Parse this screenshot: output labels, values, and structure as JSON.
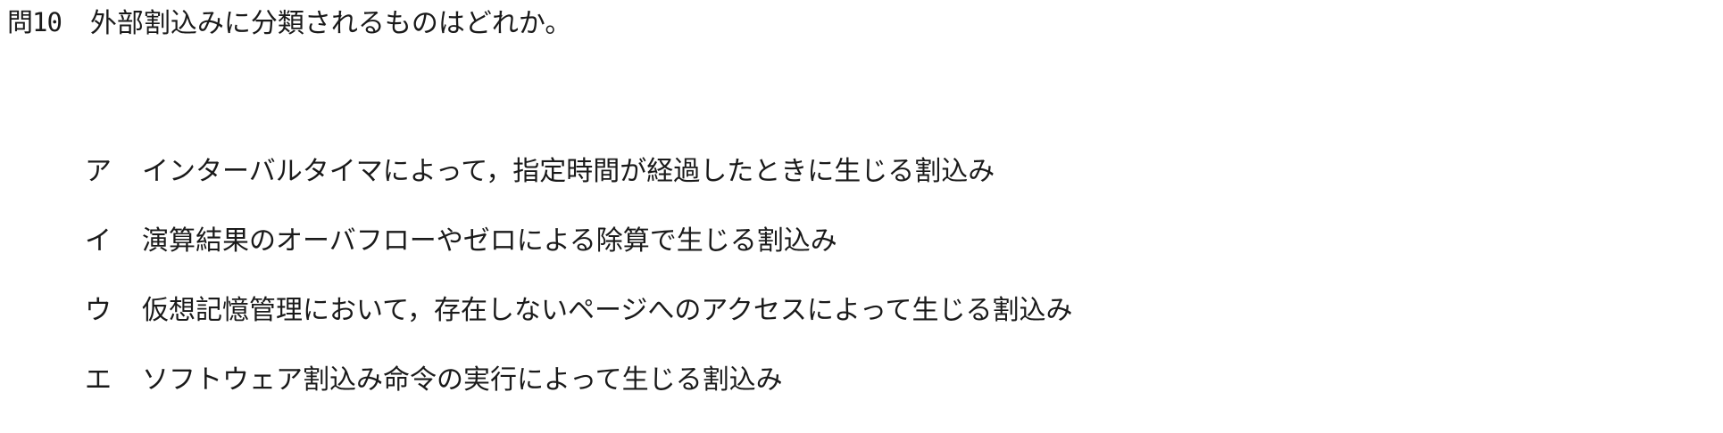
{
  "question": {
    "number": "問10",
    "text": "外部割込みに分類されるものはどれか。"
  },
  "choices": [
    {
      "label": "ア",
      "text": "インターバルタイマによって，指定時間が経過したときに生じる割込み"
    },
    {
      "label": "イ",
      "text": "演算結果のオーバフローやゼロによる除算で生じる割込み"
    },
    {
      "label": "ウ",
      "text": "仮想記憶管理において，存在しないページへのアクセスによって生じる割込み"
    },
    {
      "label": "エ",
      "text": "ソフトウェア割込み命令の実行によって生じる割込み"
    }
  ]
}
